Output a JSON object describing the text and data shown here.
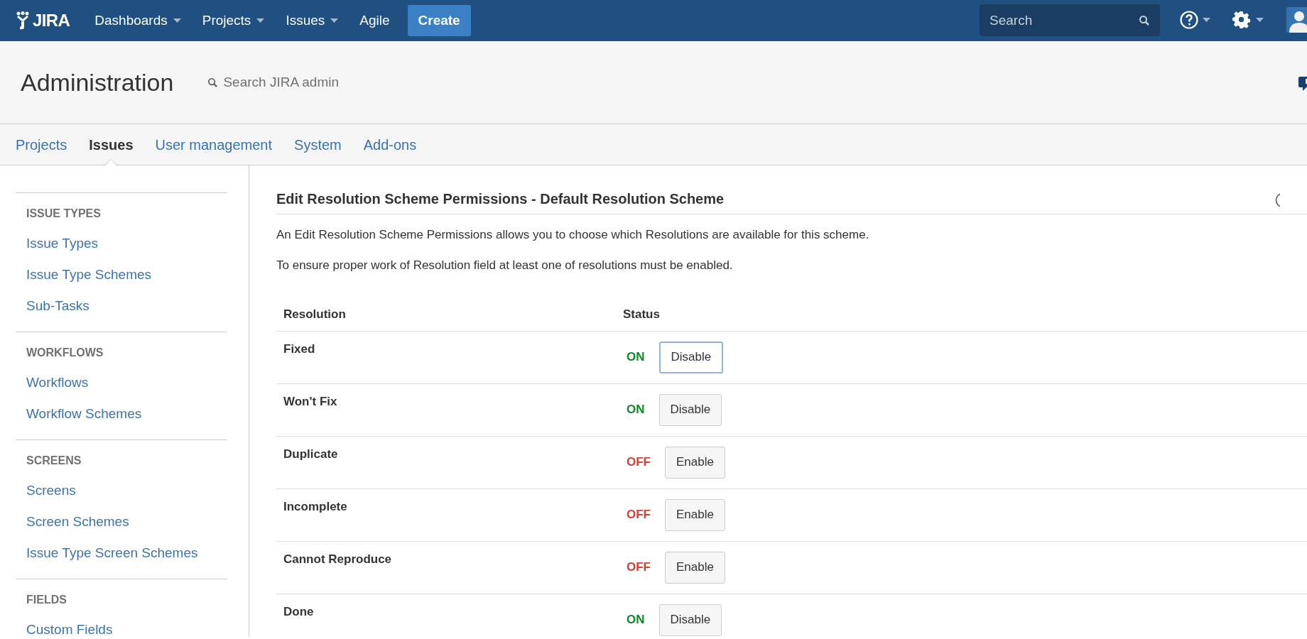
{
  "topbar": {
    "logo": "JIRA",
    "menus": [
      {
        "label": "Dashboards",
        "dropdown": true
      },
      {
        "label": "Projects",
        "dropdown": true
      },
      {
        "label": "Issues",
        "dropdown": true
      },
      {
        "label": "Agile",
        "dropdown": false
      }
    ],
    "create": "Create",
    "search": {
      "placeholder": "Search"
    }
  },
  "header": {
    "title": "Administration",
    "search": {
      "placeholder": "Search JIRA admin"
    }
  },
  "tabs": [
    {
      "label": "Projects",
      "selected": false
    },
    {
      "label": "Issues",
      "selected": true
    },
    {
      "label": "User management",
      "selected": false
    },
    {
      "label": "System",
      "selected": false
    },
    {
      "label": "Add-ons",
      "selected": false
    }
  ],
  "sidebar": {
    "sections": [
      {
        "heading": "ISSUE TYPES",
        "items": [
          "Issue Types",
          "Issue Type Schemes",
          "Sub-Tasks"
        ]
      },
      {
        "heading": "WORKFLOWS",
        "items": [
          "Workflows",
          "Workflow Schemes"
        ]
      },
      {
        "heading": "SCREENS",
        "items": [
          "Screens",
          "Screen Schemes",
          "Issue Type Screen Schemes"
        ]
      },
      {
        "heading": "FIELDS",
        "items": [
          "Custom Fields"
        ]
      }
    ]
  },
  "content": {
    "title": "Edit Resolution Scheme Permissions - Default Resolution Scheme",
    "paragraphs": [
      "An Edit Resolution Scheme Permissions allows you to choose which Resolutions are available for this scheme.",
      "To ensure proper work of Resolution field at least one of resolutions must be enabled."
    ],
    "table": {
      "columns": [
        "Resolution",
        "Status"
      ],
      "rows": [
        {
          "resolution": "Fixed",
          "on": true,
          "status": "ON",
          "action": "Disable",
          "focused": true
        },
        {
          "resolution": "Won't Fix",
          "on": true,
          "status": "ON",
          "action": "Disable",
          "focused": false
        },
        {
          "resolution": "Duplicate",
          "on": false,
          "status": "OFF",
          "action": "Enable",
          "focused": false
        },
        {
          "resolution": "Incomplete",
          "on": false,
          "status": "OFF",
          "action": "Enable",
          "focused": false
        },
        {
          "resolution": "Cannot Reproduce",
          "on": false,
          "status": "OFF",
          "action": "Enable",
          "focused": false
        },
        {
          "resolution": "Done",
          "on": true,
          "status": "ON",
          "action": "Disable",
          "focused": false
        }
      ]
    }
  }
}
